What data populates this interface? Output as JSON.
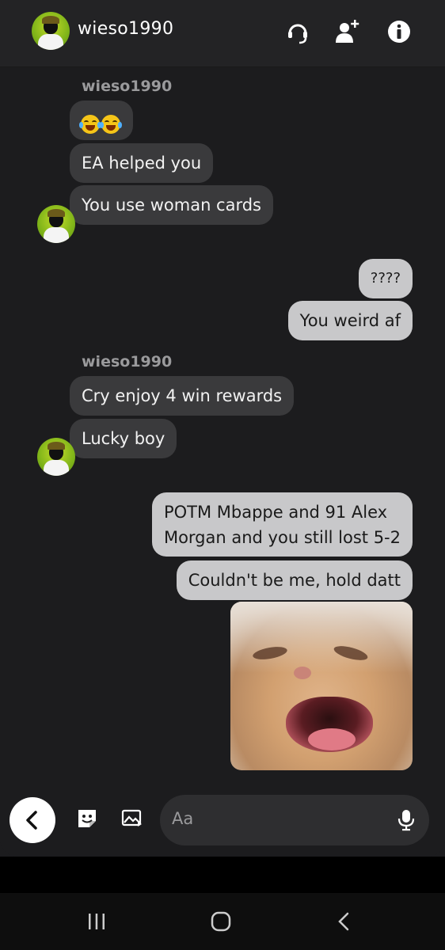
{
  "header": {
    "username": "wieso1990",
    "icons": [
      "headset-icon",
      "add-user-icon",
      "info-icon"
    ]
  },
  "thread": [
    {
      "type": "sender",
      "text": "wieso1990"
    },
    {
      "type": "incoming",
      "text": "😂😂"
    },
    {
      "type": "incoming",
      "text": "EA helped you"
    },
    {
      "type": "incoming",
      "text": "You use woman cards"
    },
    {
      "type": "outgoing",
      "text": "????"
    },
    {
      "type": "outgoing",
      "text": "You weird af"
    },
    {
      "type": "sender",
      "text": "wieso1990"
    },
    {
      "type": "incoming",
      "text": "Cry enjoy 4 win rewards"
    },
    {
      "type": "incoming",
      "text": "Lucky boy"
    },
    {
      "type": "outgoing",
      "text": "POTM Mbappe and 91 Alex\nMorgan and you still lost 5-2"
    },
    {
      "type": "outgoing",
      "text": "Couldn't be me, hold datt"
    },
    {
      "type": "image",
      "text": ""
    }
  ],
  "senders": {
    "s1": "wieso1990",
    "s2": "wieso1990"
  },
  "messages": {
    "m1": "EA helped you",
    "m2": "You use woman cards",
    "m3": "????",
    "m4": "You weird af",
    "m5": "Cry enjoy 4 win rewards",
    "m6": "Lucky boy",
    "m7a": "POTM Mbappe and 91 Alex",
    "m7b": "Morgan and you still lost 5-2",
    "m8": "Couldn't be me, hold datt"
  },
  "composer": {
    "placeholder": "Aa",
    "icons": [
      "back-icon",
      "sticker-icon",
      "gallery-icon",
      "microphone-icon"
    ]
  },
  "colors": {
    "background": "#1c1c1e",
    "incoming_bubble": "#3a3a3c",
    "outgoing_bubble": "#c8c8ca",
    "sender_name": "#9a9a9c"
  }
}
